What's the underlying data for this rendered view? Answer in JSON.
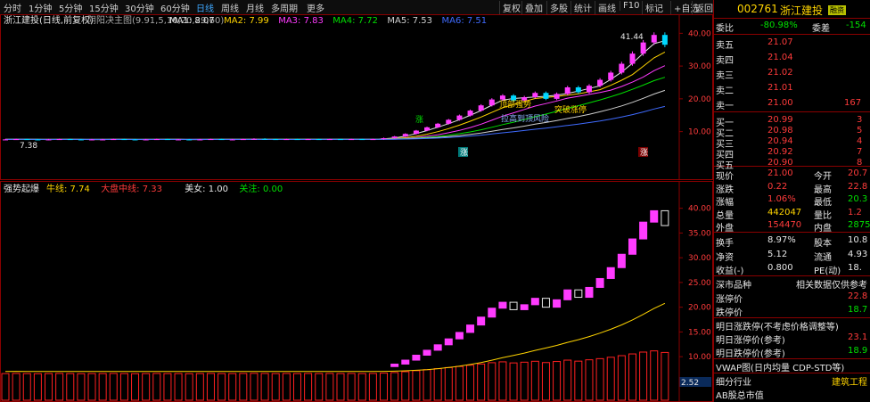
{
  "toolbar": {
    "periods": [
      "分时",
      "1分钟",
      "5分钟",
      "15分钟",
      "30分钟",
      "60分钟",
      "日线",
      "周线",
      "月线",
      "多周期",
      "更多"
    ],
    "active_period": "日线",
    "buttons": [
      "复权",
      "叠加",
      "多股",
      "统计",
      "画线",
      "F10",
      "标记",
      "+自选",
      "返回"
    ]
  },
  "main_indicator": {
    "title": "浙江建投(日线,前复权)",
    "formula": "阴阳决主图(9.91,5,10,20,29,60)",
    "ma": [
      {
        "label": "MA1: 8.07",
        "color": "#e6e6e6"
      },
      {
        "label": "MA2: 7.99",
        "color": "#ffd400"
      },
      {
        "label": "MA3: 7.83",
        "color": "#ff3bff"
      },
      {
        "label": "MA4: 7.72",
        "color": "#00e000"
      },
      {
        "label": "MA5: 7.53",
        "color": "#cfcfcf"
      },
      {
        "label": "MA6: 7.51",
        "color": "#3f6bff"
      }
    ],
    "price_axis": [
      "40.00",
      "30.00",
      "20.00",
      "10.00"
    ],
    "high_label": "41.44",
    "low_label": "7.38",
    "annotations": [
      "拉高到顶风险",
      "顶部强势",
      "突破涨停",
      "涨"
    ],
    "markers": [
      "涨",
      "涨"
    ]
  },
  "sub_indicator": {
    "title": "强势起爆",
    "items": [
      {
        "label": "牛线: 7.74",
        "color": "#ffd400"
      },
      {
        "label": "大盘中线: 7.33",
        "color": "#ff3b3b"
      },
      {
        "label": "美女: 1.00",
        "color": "#e6e6e6"
      },
      {
        "label": "关注: 0.00",
        "color": "#00e000"
      }
    ],
    "price_axis": [
      "40.00",
      "35.00",
      "30.00",
      "25.00",
      "20.00",
      "15.00",
      "10.00",
      "5.00"
    ],
    "last_value": "2.52"
  },
  "chart_data": {
    "type": "candlestick",
    "close": [
      7.6,
      7.7,
      7.6,
      7.5,
      7.6,
      7.7,
      7.6,
      7.5,
      7.6,
      7.6,
      7.7,
      7.6,
      7.5,
      7.6,
      7.7,
      7.6,
      7.6,
      7.5,
      7.6,
      7.7,
      7.6,
      7.6,
      7.7,
      7.8,
      7.7,
      7.6,
      7.7,
      7.6,
      7.7,
      7.6,
      7.7,
      7.6,
      7.7,
      7.6,
      7.7,
      8.0,
      8.5,
      9.3,
      10.3,
      11.3,
      12.4,
      13.6,
      14.9,
      16.4,
      18.0,
      19.8,
      21.0,
      19.5,
      20.5,
      21.8,
      20.0,
      21.5,
      23.5,
      22.0,
      24.0,
      25.8,
      28.0,
      30.7,
      33.8,
      37.2,
      39.5,
      36.5
    ],
    "y_range": [
      5,
      42
    ]
  },
  "panel": {
    "code": "002761",
    "name": "浙江建投",
    "tag": "融资",
    "weibi_label": "委比",
    "weibi_value": "-80.98%",
    "weicha_label": "委差",
    "weicha_value": "-154",
    "asks": [
      {
        "label": "卖五",
        "price": "21.07",
        "vol": ""
      },
      {
        "label": "卖四",
        "price": "21.04",
        "vol": ""
      },
      {
        "label": "卖三",
        "price": "21.02",
        "vol": ""
      },
      {
        "label": "卖二",
        "price": "21.01",
        "vol": ""
      },
      {
        "label": "卖一",
        "price": "21.00",
        "vol": "167"
      }
    ],
    "bids": [
      {
        "label": "买一",
        "price": "20.99",
        "vol": "3"
      },
      {
        "label": "买二",
        "price": "20.98",
        "vol": "5"
      },
      {
        "label": "买三",
        "price": "20.94",
        "vol": "4"
      },
      {
        "label": "买四",
        "price": "20.92",
        "vol": "7"
      },
      {
        "label": "买五",
        "price": "20.90",
        "vol": "8"
      }
    ],
    "quote": [
      {
        "l1": "现价",
        "v1": "21.00",
        "c1": "red",
        "l2": "今开",
        "v2": "20.7",
        "c2": "red"
      },
      {
        "l1": "涨跌",
        "v1": "0.22",
        "c1": "red",
        "l2": "最高",
        "v2": "22.8",
        "c2": "red"
      },
      {
        "l1": "涨幅",
        "v1": "1.06%",
        "c1": "red",
        "l2": "最低",
        "v2": "20.3",
        "c2": "green"
      },
      {
        "l1": "总量",
        "v1": "442047",
        "c1": "yellow",
        "l2": "量比",
        "v2": "1.2",
        "c2": "red"
      },
      {
        "l1": "外盘",
        "v1": "154470",
        "c1": "red",
        "l2": "内盘",
        "v2": "28757",
        "c2": "green"
      }
    ],
    "fundamentals": [
      {
        "l1": "换手",
        "v1": "8.97%",
        "l2": "股本",
        "v2": "10.8"
      },
      {
        "l1": "净资",
        "v1": "5.12",
        "l2": "流通",
        "v2": "4.93"
      },
      {
        "l1": "收益(-)",
        "v1": "0.800",
        "l2": "PE(动)",
        "v2": "18."
      }
    ],
    "market_label": "深市品种",
    "market_note": "相关数据仅供参考",
    "limit_up_label": "涨停价",
    "limit_up": "22.8",
    "limit_down_label": "跌停价",
    "limit_down": "18.7",
    "next_note": "明日涨跌停(不考虑价格调整等)",
    "next_up_label": "明日涨停价(参考)",
    "next_up": "23.1",
    "next_down_label": "明日跌停价(参考)",
    "next_down": "18.9",
    "vwap": "VWAP图(日内均量 CDP-STD等)",
    "industry_label": "细分行业",
    "industry_value": "建筑工程",
    "ab_label": "AB股总市值"
  }
}
